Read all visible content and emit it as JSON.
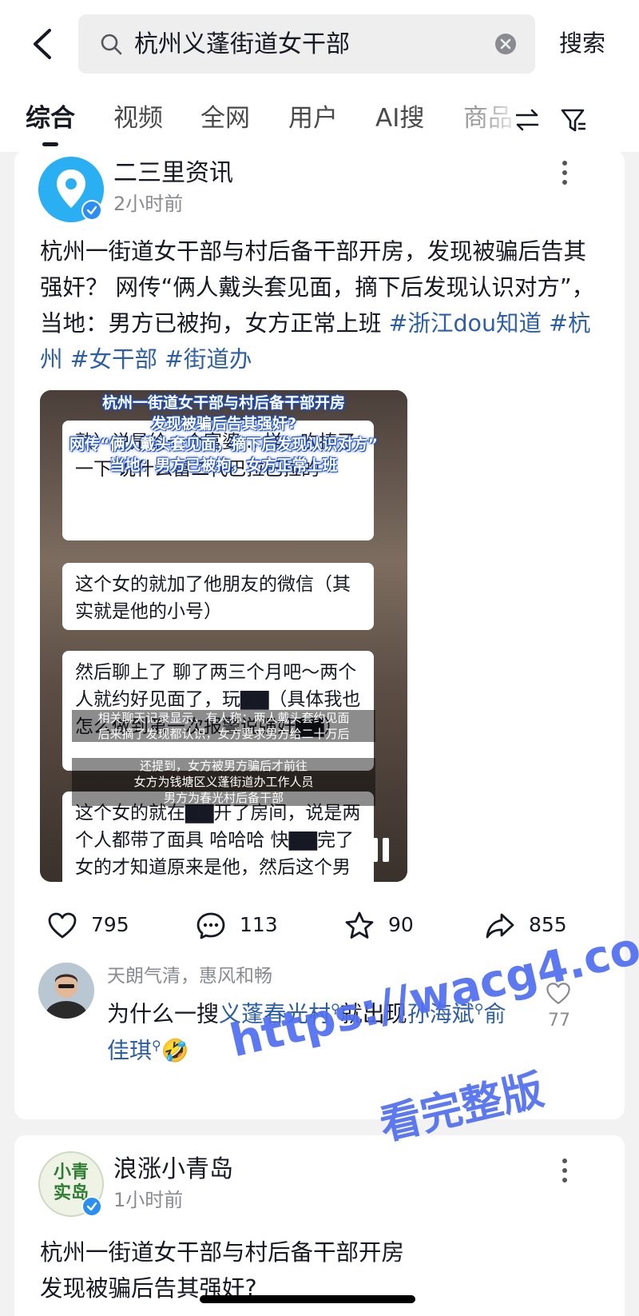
{
  "search": {
    "query": "杭州义蓬街道女干部",
    "submit_label": "搜索"
  },
  "tabs": [
    {
      "label": "综合",
      "active": true
    },
    {
      "label": "视频"
    },
    {
      "label": "全网"
    },
    {
      "label": "用户"
    },
    {
      "label": "AI搜"
    },
    {
      "label": "商品"
    }
  ],
  "posts": [
    {
      "author": "二三里资讯",
      "time": "2小时前",
      "text": "杭州一街道女干部与村后备干部开房，发现被骗后告其强奸？ 网传“俩人戴头套见面，摘下后发现认识对方”，当地：男方已被拘，女方正常上班 ",
      "hashtags": [
        "#浙江dou知道",
        "#杭州",
        "#女干部",
        "#街道办"
      ],
      "video": {
        "title_lines": [
          "杭州一街道女干部与村后备干部开房",
          "发现被骗后告其强奸?",
          "网传“俩人戴头套见面，摘下后发现认识对方”",
          "当地：男方已被拘，女方正常上班"
        ],
        "bubbles": [
          "熟）说是给一个富婆... 样，吹捧了一下 说什么富二代巴拉巴拉的",
          "这个女的就加了他朋友的微信（其实就是他的小号）",
          "然后聊上了 聊了两三个月吧～两个人就约好见面了，玩▇▇（具体我也怎么做到第一次报警说强奸▇▇）",
          "这个女的就在▇▇开了房间，说是两个人都带了面具 哈哈哈 快▇▇完了女的才知道原来是他，然后这个男"
        ],
        "subtitle_lines": [
          "相关聊天记录显示，有人称：两人戴头套约见面",
          "后来摘了发现都认识，女方要求男方给二十万后",
          "还提到，女方被男方骗后才前往",
          "女方为钱塘区义蓬街道办工作人员",
          "男方为春光村后备干部"
        ]
      },
      "stats": {
        "likes": "795",
        "comments": "113",
        "favorites": "90",
        "shares": "855"
      },
      "top_comment": {
        "user": "天朗气清，惠风和畅",
        "text_parts": [
          "为什么一搜",
          "义蓬春光村",
          "就出现",
          "孙海斌",
          "俞佳琪",
          "🤣"
        ],
        "likes": "77"
      }
    },
    {
      "author": "浪涨小青岛",
      "time": "1小时前",
      "text_lines": [
        "杭州一街道女干部与村后备干部开房",
        "发现被骗后告其强奸?"
      ],
      "avatar_glyphs": "小青 实岛"
    }
  ],
  "watermark": {
    "line1": "https://wacg4.com",
    "line2": "看完整版"
  },
  "colors": {
    "hashtag": "#2d5ea8",
    "verified": "#2b8ef2",
    "watermark": "#4f6ef0"
  }
}
